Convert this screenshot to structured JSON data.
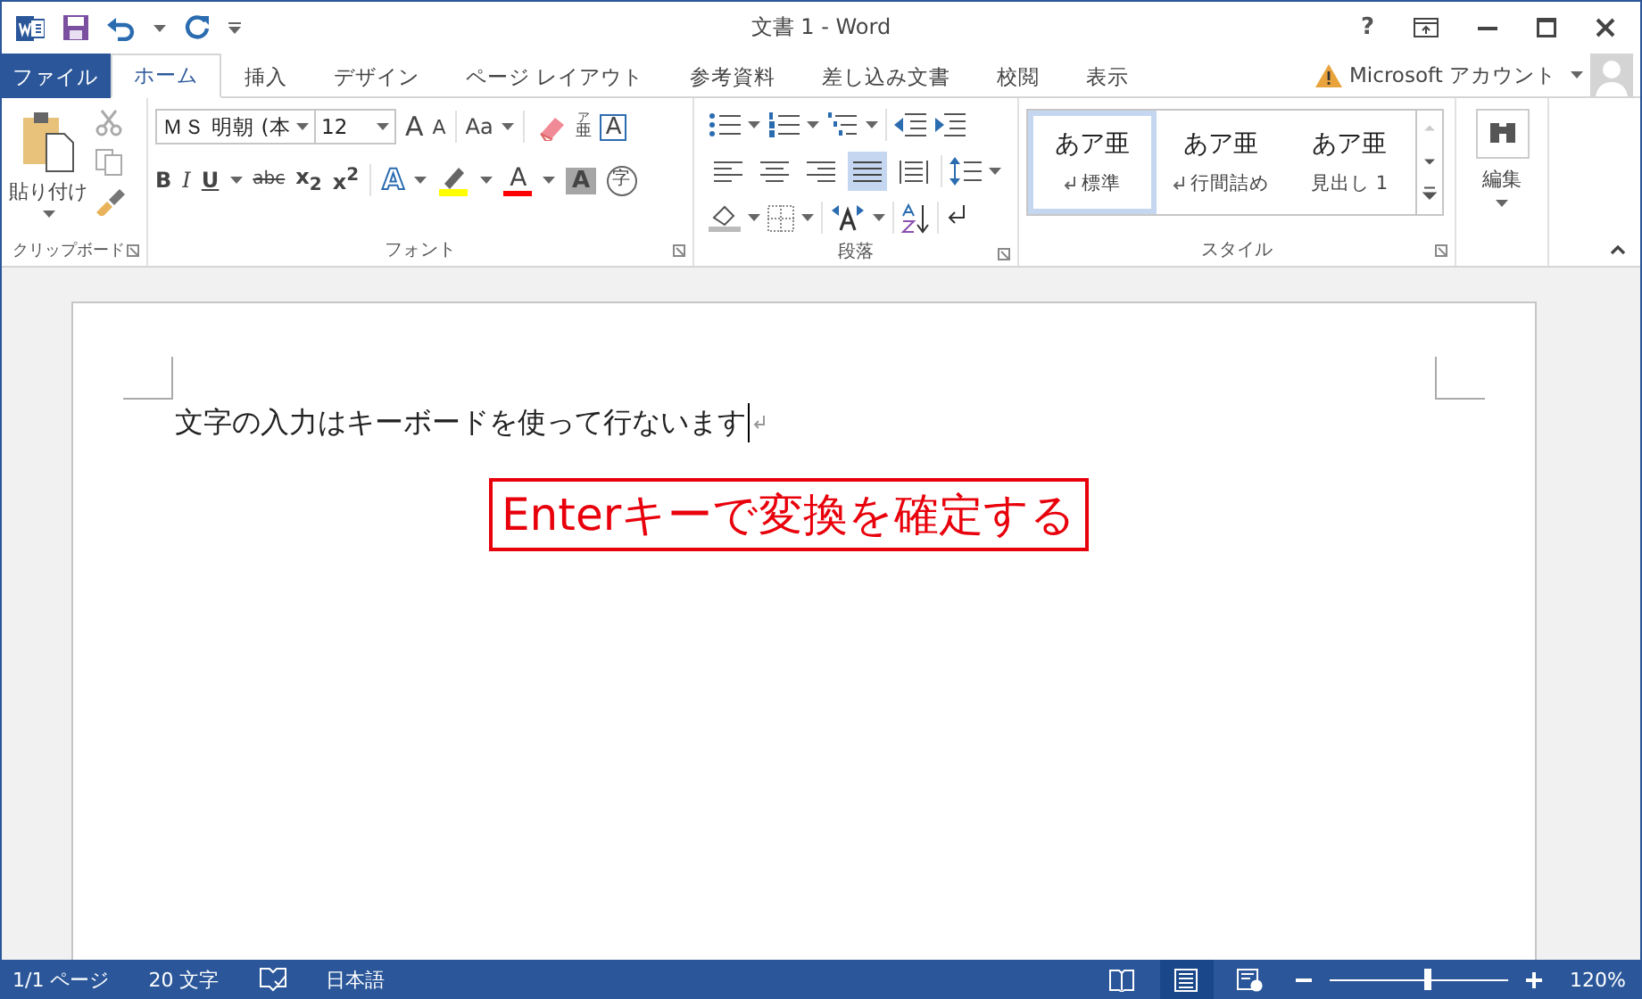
{
  "window": {
    "title": "文書 1 - Word",
    "help": "?"
  },
  "tabs": [
    {
      "label": "ファイル",
      "kind": "file",
      "selected": false
    },
    {
      "label": "ホーム",
      "kind": "tab",
      "selected": true
    },
    {
      "label": "挿入",
      "kind": "tab",
      "selected": false
    },
    {
      "label": "デザイン",
      "kind": "tab",
      "selected": false
    },
    {
      "label": "ページ レイアウト",
      "kind": "tab",
      "selected": false
    },
    {
      "label": "参考資料",
      "kind": "tab",
      "selected": false
    },
    {
      "label": "差し込み文書",
      "kind": "tab",
      "selected": false
    },
    {
      "label": "校閲",
      "kind": "tab",
      "selected": false
    },
    {
      "label": "表示",
      "kind": "tab",
      "selected": false
    }
  ],
  "account": {
    "name": "Microsoft アカウント"
  },
  "ribbon": {
    "clipboard": {
      "paste": "貼り付け",
      "label": "クリップボード"
    },
    "font": {
      "label": "フォント",
      "font_name": "ＭＳ 明朝 (本",
      "font_size": "12",
      "row1": [
        {
          "kind": "grow",
          "text": "A"
        },
        {
          "kind": "shrink",
          "text": "A"
        },
        {
          "kind": "case",
          "text": "Aa"
        },
        {
          "kind": "clear"
        },
        {
          "kind": "phonetic",
          "text": "亜",
          "ruby": "ア"
        },
        {
          "kind": "border",
          "text": "A"
        }
      ],
      "row2": [
        {
          "kind": "plain",
          "text": "B"
        },
        {
          "kind": "plain",
          "text": "I"
        },
        {
          "kind": "plain",
          "text": "U",
          "dropdown": true
        },
        {
          "kind": "plain",
          "text": "abc"
        },
        {
          "kind": "plain",
          "text": "x$_{2}$"
        },
        {
          "kind": "plain",
          "text": "x$^{2}$"
        },
        {
          "kind": "effect",
          "text": "A",
          "dropdown": true
        },
        {
          "kind": "highlight",
          "color": "#ffff00",
          "dropdown": true
        },
        {
          "kind": "fontcolor",
          "text": "A",
          "color": "#ff0000",
          "dropdown": true
        },
        {
          "kind": "shade",
          "text": "A"
        },
        {
          "kind": "enclose",
          "text": "字"
        }
      ]
    },
    "paragraph": {
      "label": "段落",
      "alignment": [
        {
          "kind": "left",
          "selected": false
        },
        {
          "kind": "center",
          "selected": false
        },
        {
          "kind": "right",
          "selected": false
        },
        {
          "kind": "justify",
          "selected": true
        },
        {
          "kind": "distribute",
          "selected": false
        }
      ]
    },
    "styles": {
      "label": "スタイル",
      "items": [
        {
          "preview": "あア亜",
          "name": "標準",
          "mark": true,
          "selected": true
        },
        {
          "preview": "あア亜",
          "name": "行間詰め",
          "mark": true,
          "selected": false
        },
        {
          "preview": "あア亜",
          "name": "見出し 1",
          "mark": false,
          "selected": false
        }
      ]
    },
    "editing": {
      "label": "編集"
    }
  },
  "document": {
    "text": "文字の入力はキーボードを使って行ないます",
    "callout": "Enterキーで変換を確定する"
  },
  "status_bar": {
    "page": "1/1 ページ",
    "words": "20 文字",
    "language": "日本語",
    "views": [
      {
        "kind": "read",
        "selected": false
      },
      {
        "kind": "print",
        "selected": true
      },
      {
        "kind": "web",
        "selected": false
      }
    ],
    "zoom": {
      "level": 0.55,
      "reading": "120%"
    }
  }
}
